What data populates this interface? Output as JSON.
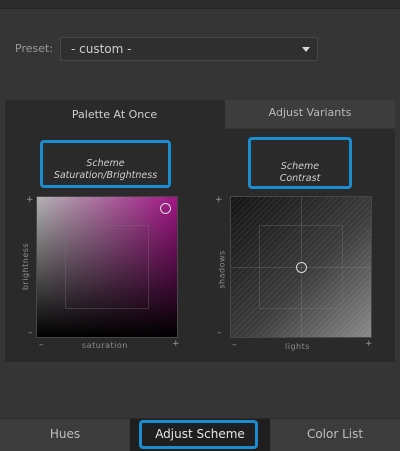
{
  "preset": {
    "label": "Preset:",
    "value": "- custom -"
  },
  "tabs_top": [
    {
      "label": "Palette At Once",
      "active": true
    },
    {
      "label": "Adjust Variants",
      "active": false
    }
  ],
  "saturation_brightness": {
    "title_line1": "Scheme",
    "title_line2": "Saturation/Brightness",
    "x_label": "saturation",
    "y_label": "brightness",
    "minus": "–",
    "plus": "+",
    "handle_saturation": 0.92,
    "handle_brightness": 0.92
  },
  "contrast": {
    "title_line1": "Scheme",
    "title_line2": "Contrast",
    "x_label": "lights",
    "y_label": "shadows",
    "minus": "–",
    "plus": "+",
    "handle_lights": 0.5,
    "handle_shadows": 0.5
  },
  "tabs_bottom": [
    {
      "label": "Hues",
      "active": false
    },
    {
      "label": "Adjust Scheme",
      "active": true
    },
    {
      "label": "Color List",
      "active": false
    }
  ],
  "colors": {
    "highlight": "#1a8ccf",
    "magenta": "#a21486"
  }
}
